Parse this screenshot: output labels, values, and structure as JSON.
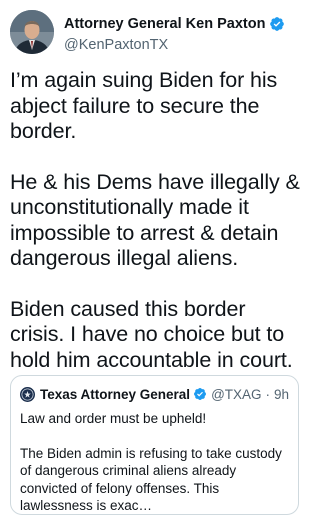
{
  "tweet": {
    "author": {
      "display_name": "Attorney General Ken Paxton",
      "handle": "@KenPaxtonTX",
      "verified": true,
      "avatar_icon": "profile-photo"
    },
    "paragraphs": [
      "I’m again suing Biden for his abject failure to secure the border.",
      "He & his Dems have illegally & unconstitutionally made it impossible to arrest & detain dangerous illegal aliens.",
      "Biden caused this border crisis. I have no choice but to hold him accountable in court."
    ]
  },
  "quoted_tweet": {
    "display_name": "Texas Attorney General",
    "handle": "@TXAG",
    "separator": "·",
    "time": "9h",
    "verified": true,
    "avatar_icon": "state-seal-icon",
    "paragraphs": [
      "Law and order must be upheld!",
      "The Biden admin is refusing to take custody of dangerous criminal aliens already convicted of felony offenses. This lawlessness is exac…"
    ]
  },
  "colors": {
    "verified_blue": "#1d9bf0",
    "text_primary": "#0f1419",
    "text_secondary": "#536471",
    "border": "#cfd9de"
  }
}
